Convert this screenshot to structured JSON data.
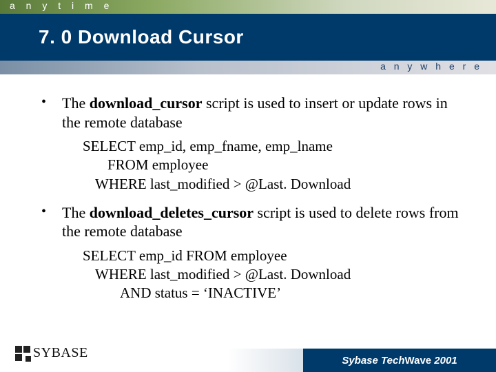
{
  "header": {
    "top_word": "a n y t i m e",
    "title": "7. 0 Download Cursor",
    "sub_word": "a n y w h e r e"
  },
  "bullets": [
    {
      "pre": "The ",
      "bold": "download_cursor",
      "post": " script is used to insert or update rows in the remote database"
    },
    {
      "pre": "The ",
      "bold": "download_deletes_cursor",
      "post": " script is used to delete rows from the remote database"
    }
  ],
  "code1": {
    "l1": "SELECT emp_id, emp_fname, emp_lname",
    "l2": "FROM employee",
    "l3": "WHERE last_modified > @Last. Download"
  },
  "code2": {
    "l1": "SELECT emp_id FROM employee",
    "l2": "WHERE last_modified > @Last. Download",
    "l3": "AND status = ‘INACTIVE’"
  },
  "footer": {
    "logo_text": "SYBASE",
    "band_prefix": "Sybase Tech",
    "band_mid": "Wave ",
    "band_year": "2001"
  }
}
